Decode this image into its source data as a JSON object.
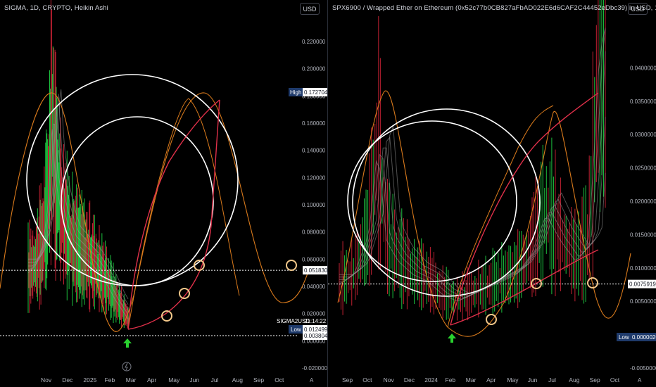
{
  "left": {
    "title": "SIGMA, 1D, CRYPTO, Heikin Ashi",
    "currency": "USD",
    "chart_data": {
      "type": "line",
      "title": "SIGMA, 1D, CRYPTO, Heikin Ashi",
      "ylim": [
        -0.02,
        0.235
      ],
      "y_ticks": [
        "0.220000",
        "0.200000",
        "0.180000",
        "0.160000",
        "0.140000",
        "0.120000",
        "0.100000",
        "0.080000",
        "0.060000",
        "0.040000",
        "0.020000",
        "0.000000",
        "-0.020000"
      ],
      "y_tick_values": [
        0.22,
        0.2,
        0.18,
        0.16,
        0.14,
        0.12,
        0.1,
        0.08,
        0.06,
        0.04,
        0.02,
        0.0,
        -0.02
      ],
      "x_ticks": [
        "Nov",
        "Dec",
        "2025",
        "Feb",
        "Mar",
        "Apr",
        "May",
        "Jun",
        "Jul",
        "Aug",
        "Sep",
        "Oct"
      ],
      "high": {
        "label": "High",
        "value": "0.172704"
      },
      "current": {
        "label": "0.051830",
        "value": 0.05183
      },
      "symbol_label": {
        "symbol": "SIGMA2USD",
        "time": "21:14:22"
      },
      "low": {
        "label": "Low",
        "value": "0.012499"
      },
      "support": {
        "label": "0.003804",
        "value": 0.003804
      },
      "price_series": [
        {
          "i": 0,
          "v": 0.05
        },
        {
          "i": 4,
          "v": 0.055
        },
        {
          "i": 8,
          "v": 0.07
        },
        {
          "i": 11,
          "v": 0.1
        },
        {
          "i": 13,
          "v": 0.16
        },
        {
          "i": 15,
          "v": 0.12
        },
        {
          "i": 18,
          "v": 0.095
        },
        {
          "i": 21,
          "v": 0.08
        },
        {
          "i": 24,
          "v": 0.07
        },
        {
          "i": 28,
          "v": 0.065
        },
        {
          "i": 32,
          "v": 0.06
        },
        {
          "i": 36,
          "v": 0.055
        },
        {
          "i": 40,
          "v": 0.048
        },
        {
          "i": 44,
          "v": 0.04
        },
        {
          "i": 48,
          "v": 0.03
        },
        {
          "i": 52,
          "v": 0.022
        },
        {
          "i": 55,
          "v": 0.016
        }
      ]
    }
  },
  "right": {
    "title": "SPX6900 / Wrapped Ether on Ethereum (0x52c77b0CB827aFbAD022E6d6CAF2C44452eDbc39) in USD, 1D, UNISWAP, Heikin Ashi",
    "currency": "USD",
    "chart_data": {
      "type": "line",
      "title": "SPX6900 / Wrapped Ether on Ethereum (0x52c77b0CB827aFbAD022E6d6CAF2C44452eDbc39) in USD, 1D, UNISWAP, Heikin Ashi",
      "ylim": [
        -0.005,
        0.047
      ],
      "y_ticks": [
        "0.0400000",
        "0.0350000",
        "0.0300000",
        "0.0250000",
        "0.0200000",
        "0.0150000",
        "0.0100000",
        "0.0050000",
        "-0.0050000"
      ],
      "y_tick_values": [
        0.04,
        0.035,
        0.03,
        0.025,
        0.02,
        0.015,
        0.01,
        0.005,
        -0.005
      ],
      "x_ticks": [
        "Sep",
        "Oct",
        "Nov",
        "Dec",
        "2024",
        "Feb",
        "Mar",
        "Apr",
        "May",
        "Jun",
        "Jul",
        "Aug",
        "Sep",
        "Oct"
      ],
      "current": {
        "label": "0.0075919",
        "value": 0.0075919
      },
      "low": {
        "label": "Low",
        "value": "0.0000026"
      },
      "price_series": [
        {
          "i": 0,
          "v": 0.0075
        },
        {
          "i": 5,
          "v": 0.009
        },
        {
          "i": 10,
          "v": 0.015
        },
        {
          "i": 13,
          "v": 0.028
        },
        {
          "i": 16,
          "v": 0.014
        },
        {
          "i": 20,
          "v": 0.011
        },
        {
          "i": 25,
          "v": 0.009
        },
        {
          "i": 30,
          "v": 0.008
        },
        {
          "i": 35,
          "v": 0.006
        },
        {
          "i": 40,
          "v": 0.005
        },
        {
          "i": 45,
          "v": 0.006
        },
        {
          "i": 50,
          "v": 0.007
        },
        {
          "i": 55,
          "v": 0.008
        },
        {
          "i": 60,
          "v": 0.009
        },
        {
          "i": 65,
          "v": 0.012
        },
        {
          "i": 70,
          "v": 0.018
        },
        {
          "i": 75,
          "v": 0.014
        },
        {
          "i": 80,
          "v": 0.011
        },
        {
          "i": 84,
          "v": 0.013
        },
        {
          "i": 86,
          "v": 0.025
        },
        {
          "i": 88,
          "v": 0.042
        },
        {
          "i": 90,
          "v": 0.046
        }
      ]
    }
  },
  "colors": {
    "background": "#000000",
    "grid": "#1c1f26",
    "candle_up": "#22e24a",
    "candle_down": "#e2263b",
    "ribbon_grey": "#a0a0a0",
    "cycle_orange": "#d97a1c",
    "arc_red": "#e0304a",
    "circle_white": "#ffffff",
    "marker_ring": "#f3c88a",
    "arrow_green": "#29d12f",
    "label_blue": "#1e3a6b"
  }
}
